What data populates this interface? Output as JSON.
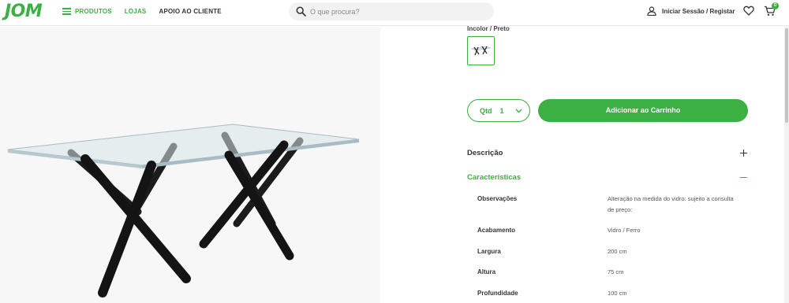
{
  "header": {
    "logo": "JOM",
    "nav": [
      {
        "label": "PRODUTOS"
      },
      {
        "label": "LOJAS"
      },
      {
        "label": "APOIO AO CLIENTE"
      }
    ],
    "search": {
      "placeholder": "O que procura?",
      "value": ""
    },
    "account_label": "Iniciar Sessão / Registar",
    "cart_count": "0"
  },
  "product": {
    "color_label": "Incolor / Preto",
    "image_alt": "Mesa de vidro com pernas cruzadas pretas"
  },
  "purchase": {
    "qty_label": "Qtd",
    "qty_value": "1",
    "add_to_cart": "Adicionar ao Carrinho"
  },
  "accordion": {
    "description": "Descrição",
    "characteristics": "Características"
  },
  "specs": [
    {
      "label": "Observações",
      "value": "Alteração na medida do vidro: sujeito a consulta de preço:"
    },
    {
      "label": "Acabamento",
      "value": "Vidro / Ferro"
    },
    {
      "label": "Largura",
      "value": "200 cm"
    },
    {
      "label": "Altura",
      "value": "75 cm"
    },
    {
      "label": "Profundidade",
      "value": "100 cm"
    }
  ],
  "colors": {
    "brand_green": "#3cb043",
    "text_dark": "#333333"
  }
}
